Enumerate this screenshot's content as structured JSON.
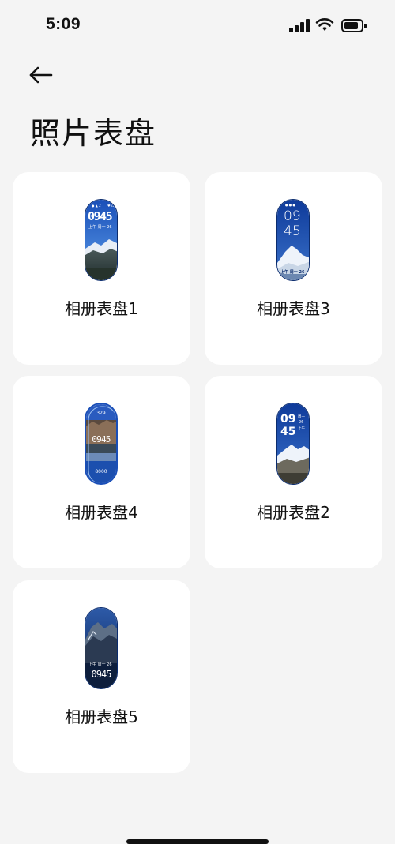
{
  "status_bar": {
    "time": "5:09"
  },
  "header": {
    "title": "照片表盘"
  },
  "faces": [
    {
      "label": "相册表盘1",
      "time_big": "0945",
      "date": "上午 周一 26"
    },
    {
      "label": "相册表盘3",
      "hour": "09",
      "minute": "45",
      "date": "上午 周一 26"
    },
    {
      "label": "相册表盘4",
      "top_value": "329",
      "time_big": "0945",
      "bottom_value": "8000"
    },
    {
      "label": "相册表盘2",
      "hour": "09",
      "minute": "45",
      "day": "周一",
      "day_num": "26",
      "ampm": "上午"
    },
    {
      "label": "相册表盘5",
      "date": "上午 周一 26",
      "time_big": "0945"
    }
  ],
  "colors": {
    "background": "#f4f4f4",
    "card": "#ffffff",
    "sky_blue": "#1f4fb0",
    "accent_dark": "#0b2c6e"
  }
}
